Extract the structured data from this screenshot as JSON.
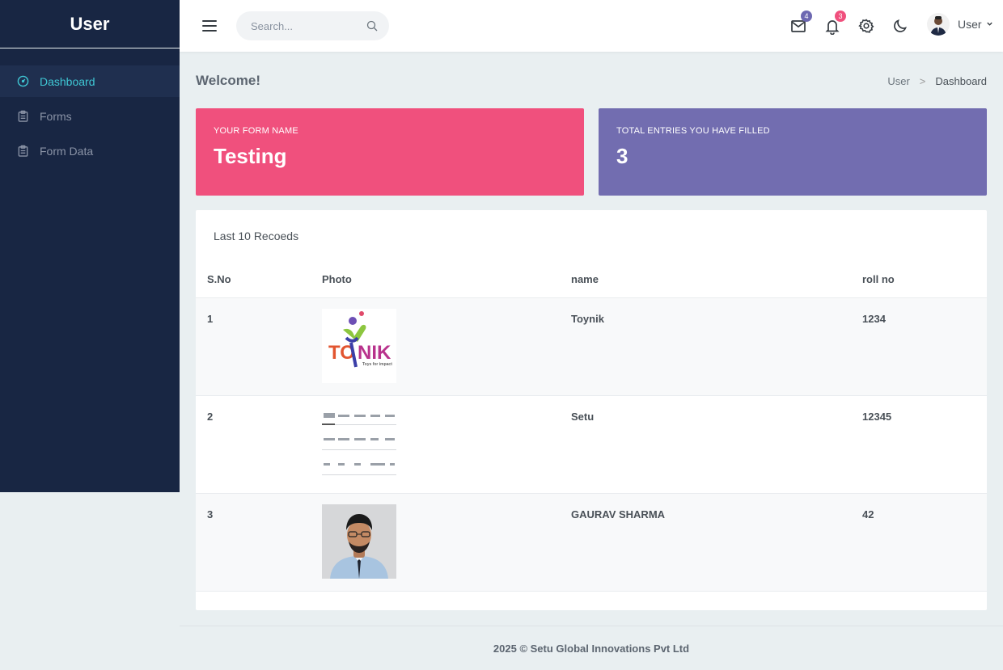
{
  "sidebar": {
    "brand": "User",
    "items": [
      {
        "label": "Dashboard",
        "icon": "dashboard-gauge-icon",
        "active": true
      },
      {
        "label": "Forms",
        "icon": "clipboard-icon",
        "active": false
      },
      {
        "label": "Form Data",
        "icon": "clipboard-icon",
        "active": false
      }
    ]
  },
  "topbar": {
    "search_placeholder": "Search...",
    "mail_badge": "4",
    "notification_badge": "3",
    "user_name": "User"
  },
  "page": {
    "title": "Welcome!",
    "breadcrumb": [
      "User",
      "Dashboard"
    ]
  },
  "cards": {
    "form_name_label": "YOUR FORM NAME",
    "form_name_value": "Testing",
    "entries_label": "TOTAL ENTRIES YOU HAVE FILLED",
    "entries_value": "3"
  },
  "records": {
    "title": "Last 10 Recoeds",
    "columns": [
      "S.No",
      "Photo",
      "name",
      "roll no"
    ],
    "rows": [
      {
        "sno": "1",
        "photo": "toynik-logo-image",
        "name": "Toynik",
        "roll": "1234"
      },
      {
        "sno": "2",
        "photo": "ui-screenshot-thumbnail",
        "name": "Setu",
        "roll": "12345"
      },
      {
        "sno": "3",
        "photo": "person-portrait-photo",
        "name": "GAURAV SHARMA",
        "roll": "42"
      }
    ]
  },
  "footer": "2025 © Setu Global Innovations Pvt Ltd",
  "colors": {
    "sidebar_bg": "#182643",
    "accent_teal": "#3fc7d4",
    "card_pink": "#f0507d",
    "card_purple": "#726db0"
  }
}
